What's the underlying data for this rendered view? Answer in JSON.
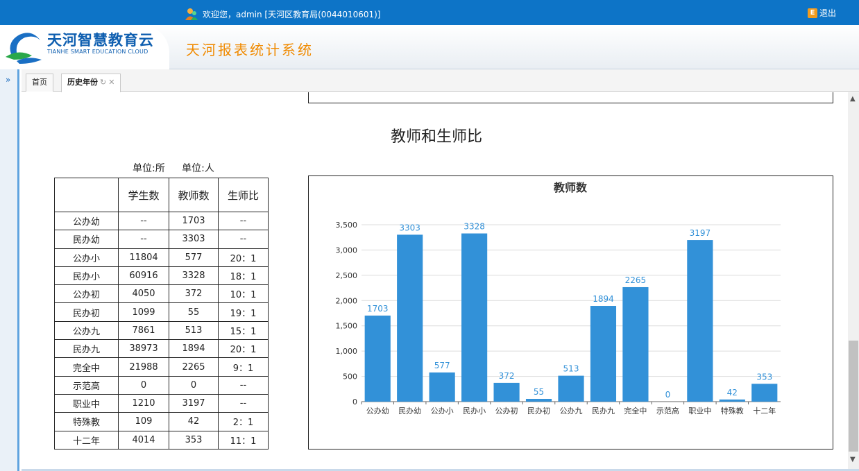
{
  "topbar": {
    "welcome": "欢迎您，admin [天河区教育局(0044010601)]",
    "logout": "退出"
  },
  "brand": {
    "name_cn": "天河智慧教育云",
    "name_en": "TIANHE SMART EDUCATION CLOUD",
    "system_title": "天河报表统计系统"
  },
  "sidebar": {
    "expand_icon": "»"
  },
  "tabs": [
    {
      "label": "首页"
    },
    {
      "label": "历史年份"
    }
  ],
  "section": {
    "title": "教师和生师比",
    "unit_school": "单位:所",
    "unit_person": "单位:人"
  },
  "table": {
    "headers": [
      "",
      "学生数",
      "教师数",
      "生师比"
    ],
    "rows": [
      [
        "公办幼",
        "--",
        "1703",
        "--"
      ],
      [
        "民办幼",
        "--",
        "3303",
        "--"
      ],
      [
        "公办小",
        "11804",
        "577",
        "20：1"
      ],
      [
        "民办小",
        "60916",
        "3328",
        "18：1"
      ],
      [
        "公办初",
        "4050",
        "372",
        "10：1"
      ],
      [
        "民办初",
        "1099",
        "55",
        "19：1"
      ],
      [
        "公办九",
        "7861",
        "513",
        "15：1"
      ],
      [
        "民办九",
        "38973",
        "1894",
        "20：1"
      ],
      [
        "完全中",
        "21988",
        "2265",
        "9：1"
      ],
      [
        "示范高",
        "0",
        "0",
        "--"
      ],
      [
        "职业中",
        "1210",
        "3197",
        "--"
      ],
      [
        "特殊教",
        "109",
        "42",
        "2：1"
      ],
      [
        "十二年",
        "4014",
        "353",
        "11：1"
      ]
    ]
  },
  "chart_data": {
    "type": "bar",
    "title": "教师数",
    "categories": [
      "公办幼",
      "民办幼",
      "公办小",
      "民办小",
      "公办初",
      "民办初",
      "公办九",
      "民办九",
      "完全中",
      "示范高",
      "职业中",
      "特殊教",
      "十二年"
    ],
    "values": [
      1703,
      3303,
      577,
      3328,
      372,
      55,
      513,
      1894,
      2265,
      0,
      3197,
      42,
      353
    ],
    "ylim": [
      0,
      3500
    ],
    "yticks": [
      "0",
      "500",
      "1,000",
      "1,500",
      "2,000",
      "2,500",
      "3,000",
      "3,500"
    ],
    "bar_color": "#3291d8",
    "label_color": "#3291d8",
    "grid": true
  }
}
